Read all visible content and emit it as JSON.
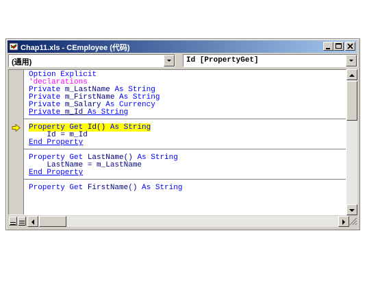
{
  "window": {
    "title": "Chap11.xls - CEmployee (代码)",
    "icon": "vba-module-icon",
    "buttons": [
      "minimize-icon",
      "maximize-icon",
      "close-icon"
    ]
  },
  "object_combo": {
    "value": "(通用)"
  },
  "procedure_combo": {
    "value": "Id [PropertyGet]"
  },
  "code": {
    "blocks": [
      [
        [
          {
            "t": "Option Explicit",
            "c": "kw"
          }
        ],
        [
          {
            "t": "'declarations",
            "c": "cm"
          }
        ],
        [
          {
            "t": "Private",
            "c": "kw"
          },
          {
            "t": " m_LastName ",
            "c": "tx"
          },
          {
            "t": "As String",
            "c": "kw"
          }
        ],
        [
          {
            "t": "Private",
            "c": "kw"
          },
          {
            "t": " m_FirstName ",
            "c": "tx"
          },
          {
            "t": "As String",
            "c": "kw"
          }
        ],
        [
          {
            "t": "Private",
            "c": "kw"
          },
          {
            "t": " m_Salary ",
            "c": "tx"
          },
          {
            "t": "As Currency",
            "c": "kw"
          }
        ],
        [
          {
            "t": "Private",
            "c": "kw"
          },
          {
            "t": " m_Id ",
            "c": "tx"
          },
          {
            "t": "As String",
            "c": "kw"
          }
        ]
      ],
      [
        [
          {
            "t": "Property Get",
            "c": "kw"
          },
          {
            "t": " Id() ",
            "c": "tx"
          },
          {
            "t": "As String",
            "c": "kw"
          }
        ],
        [
          {
            "t": "    Id = m_Id",
            "c": "tx"
          }
        ],
        [
          {
            "t": "End Property",
            "c": "kw"
          }
        ]
      ],
      [
        [
          {
            "t": "Property Get",
            "c": "kw"
          },
          {
            "t": " LastName() ",
            "c": "tx"
          },
          {
            "t": "As String",
            "c": "kw"
          }
        ],
        [
          {
            "t": "    LastName = m_LastName",
            "c": "tx"
          }
        ],
        [
          {
            "t": "End Property",
            "c": "kw"
          }
        ]
      ],
      [
        [
          {
            "t": "Property Get",
            "c": "kw"
          },
          {
            "t": " FirstName() ",
            "c": "tx"
          },
          {
            "t": "As String",
            "c": "kw"
          }
        ]
      ]
    ],
    "current_line": "Property Get Id() As String",
    "current_marker": "execution-arrow-icon"
  },
  "colors": {
    "keyword": "#0000ff",
    "comment": "#ff00ff",
    "identifier": "#000080",
    "highlight": "#ffff00",
    "titlebar": "#0a246a"
  }
}
